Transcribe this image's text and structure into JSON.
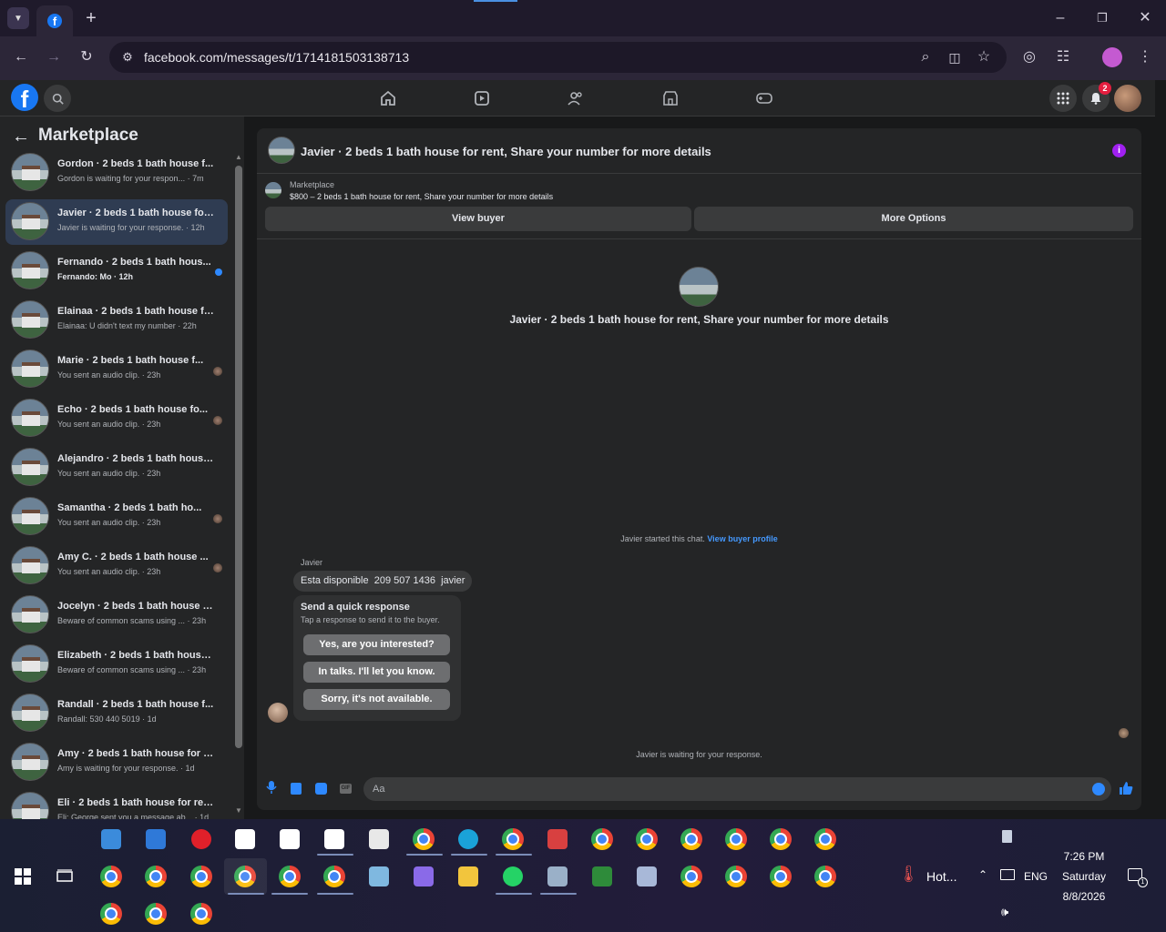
{
  "browser": {
    "tab_icon": "facebook-icon",
    "url": "facebook.com/messages/t/1714181503138713",
    "profile_letter": "",
    "new_tab": "+"
  },
  "header": {
    "notifications_count": "2"
  },
  "sidebar": {
    "title": "Marketplace",
    "conversations": [
      {
        "name": "Gordon · 2 beds 1 bath house f...",
        "sub": "Gordon is waiting for your respon... · 7m",
        "bold": false,
        "mark": ""
      },
      {
        "name": "Javier · 2 beds 1 bath house for ...",
        "sub": "Javier is waiting for your response. · 12h",
        "bold": false,
        "mark": "",
        "selected": true
      },
      {
        "name": "Fernando · 2 beds 1 bath hous...",
        "sub": "Fernando: Mo · 12h",
        "bold": true,
        "mark": "unread"
      },
      {
        "name": "Elainaa · 2 beds 1 bath house fo...",
        "sub": "Elainaa: U didn't text my number · 22h",
        "bold": false,
        "mark": ""
      },
      {
        "name": "Marie · 2 beds 1 bath house f...",
        "sub": "You sent an audio clip. · 23h",
        "bold": false,
        "mark": "seen"
      },
      {
        "name": "Echo · 2 beds 1 bath house fo...",
        "sub": "You sent an audio clip. · 23h",
        "bold": false,
        "mark": "seen"
      },
      {
        "name": "Alejandro · 2 beds 1 bath house...",
        "sub": "You sent an audio clip. · 23h",
        "bold": false,
        "mark": ""
      },
      {
        "name": "Samantha · 2 beds 1 bath ho...",
        "sub": "You sent an audio clip. · 23h",
        "bold": false,
        "mark": "seen"
      },
      {
        "name": "Amy C. · 2 beds 1 bath house ...",
        "sub": "You sent an audio clip. · 23h",
        "bold": false,
        "mark": "seen"
      },
      {
        "name": "Jocelyn · 2 beds 1 bath house fo...",
        "sub": "Beware of common scams using ... · 23h",
        "bold": false,
        "mark": ""
      },
      {
        "name": "Elizabeth · 2 beds 1 bath house ...",
        "sub": "Beware of common scams using ... · 23h",
        "bold": false,
        "mark": ""
      },
      {
        "name": "Randall · 2 beds 1 bath house f...",
        "sub": "Randall: 530 440 5019 · 1d",
        "bold": false,
        "mark": ""
      },
      {
        "name": "Amy · 2 beds 1 bath house for r...",
        "sub": "Amy is waiting for your response. · 1d",
        "bold": false,
        "mark": ""
      },
      {
        "name": "Eli · 2 beds 1 bath house for ren...",
        "sub": "Eli: George sent you a message ab... · 1d",
        "bold": false,
        "mark": ""
      }
    ]
  },
  "chat": {
    "title": "Javier · 2 beds 1 bath house for rent, Share your number for more details",
    "listing_source": "Marketplace",
    "listing_line": "$800 – 2 beds 1 bath house for rent, Share your number for more details",
    "view_buyer": "View buyer",
    "more_options": "More Options",
    "center_title": "Javier · 2 beds 1 bath house for rent, Share your number for more details",
    "started_text": "Javier started this chat.",
    "view_profile": "View buyer profile",
    "sender": "Javier",
    "message": "Esta disponible  209 507 1436  javier",
    "quick_title": "Send a quick response",
    "quick_sub": "Tap a response to send it to the buyer.",
    "quick_responses": [
      "Yes, are you interested?",
      "In talks. I'll let you know.",
      "Sorry, it's not available."
    ],
    "waiting": "Javier is waiting for your response.",
    "composer_placeholder": "Aa"
  },
  "taskbar": {
    "weather": "Hot...",
    "lang": "ENG",
    "time": "7:26 PM",
    "day": "Saturday",
    "date": "8/8/2026",
    "notif_count": "1"
  },
  "colors": {
    "accent": "#1877f2",
    "chrome_bg": "#2c2638",
    "fb_bg": "#242526",
    "unread_dot": "#2e89ff"
  }
}
